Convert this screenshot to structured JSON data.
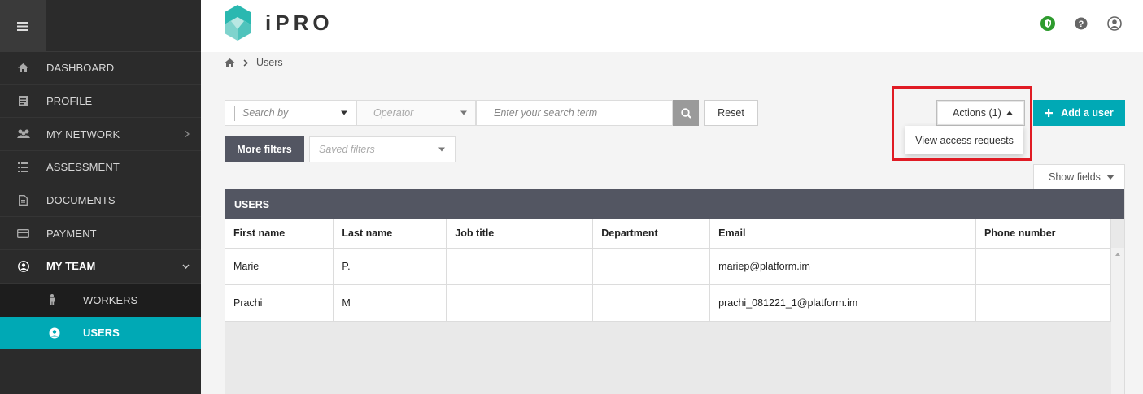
{
  "app": {
    "name": "iPRO"
  },
  "sidebar": {
    "items": [
      {
        "label": "DASHBOARD",
        "icon": "home-icon"
      },
      {
        "label": "PROFILE",
        "icon": "profile-icon"
      },
      {
        "label": "MY NETWORK",
        "icon": "network-icon"
      },
      {
        "label": "ASSESSMENT",
        "icon": "assessment-icon"
      },
      {
        "label": "DOCUMENTS",
        "icon": "documents-icon"
      },
      {
        "label": "PAYMENT",
        "icon": "payment-icon"
      },
      {
        "label": "MY TEAM",
        "icon": "team-icon"
      }
    ],
    "subitems": [
      {
        "label": "WORKERS",
        "icon": "worker-icon"
      },
      {
        "label": "USERS",
        "icon": "user-icon"
      }
    ]
  },
  "breadcrumb": {
    "current": "Users"
  },
  "filters": {
    "search_by_placeholder": "Search by",
    "operator_placeholder": "Operator",
    "term_placeholder": "Enter your search term",
    "reset_label": "Reset",
    "more_filters_label": "More filters",
    "saved_filters_placeholder": "Saved filters"
  },
  "actions": {
    "button_label": "Actions (1)",
    "menu_items": [
      "View access requests"
    ],
    "add_user_label": "Add a user",
    "show_fields_label": "Show fields"
  },
  "table": {
    "title": "USERS",
    "columns": [
      "First name",
      "Last name",
      "Job title",
      "Department",
      "Email",
      "Phone number"
    ],
    "rows": [
      [
        "Marie",
        "P.",
        "",
        "",
        "mariep@platform.im",
        ""
      ],
      [
        "Prachi",
        "M",
        "",
        "",
        "prachi_081221_1@platform.im",
        ""
      ]
    ]
  },
  "colors": {
    "accent": "#00a9b5",
    "sidebar": "#2b2b2b",
    "highlight": "#e01b24",
    "table_header": "#535662"
  }
}
